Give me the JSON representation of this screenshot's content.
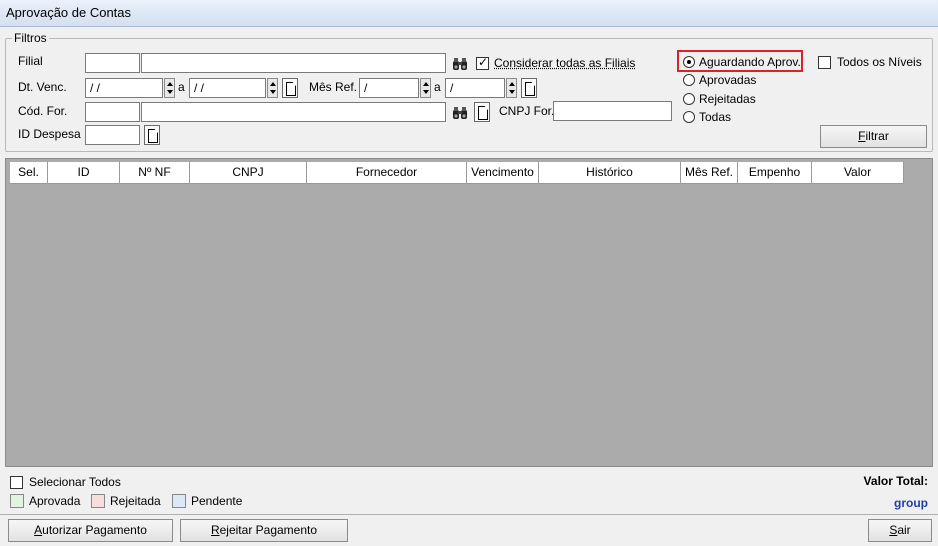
{
  "window": {
    "title": "Aprovação de Contas"
  },
  "filters": {
    "legend": "Filtros",
    "filial": {
      "label": "Filial",
      "code": "",
      "name": ""
    },
    "consider_all": {
      "label": "Considerar todas as Filiais",
      "checked": true
    },
    "dt_venc": {
      "label": "Dt. Venc.",
      "from": " / /",
      "sep": "a",
      "to": " / /"
    },
    "mes_ref": {
      "label": "Mês Ref.",
      "from": " /",
      "sep": "a",
      "to": " /"
    },
    "cod_for": {
      "label": "Cód. For.",
      "code": "",
      "name": ""
    },
    "cnpj_for": {
      "label": "CNPJ For.",
      "value": ""
    },
    "id_despesa": {
      "label": "ID Despesa",
      "value": ""
    },
    "status_options": [
      {
        "label": "Aguardando Aprov.",
        "checked": true
      },
      {
        "label": "Aprovadas",
        "checked": false
      },
      {
        "label": "Rejeitadas",
        "checked": false
      },
      {
        "label": "Todas",
        "checked": false
      }
    ],
    "all_levels": {
      "label": "Todos os Níveis",
      "checked": false
    },
    "filter_button": {
      "label_prefix": "F",
      "label_rest": "iltrar"
    }
  },
  "grid": {
    "columns": [
      "Sel.",
      "ID",
      "Nº NF",
      "CNPJ",
      "Fornecedor",
      "Vencimento",
      "Histórico",
      "Mês Ref.",
      "Empenho",
      "Valor"
    ]
  },
  "footer": {
    "select_all": {
      "label": "Selecionar Todos",
      "checked": false
    },
    "legend": [
      {
        "label": "Aprovada",
        "color": "#dff5df"
      },
      {
        "label": "Rejeitada",
        "color": "#f9dcdc"
      },
      {
        "label": "Pendente",
        "color": "#dce8f9"
      }
    ],
    "total_label": "Valor Total:",
    "total_value": "group",
    "total_value_color": "#1f3fa8"
  },
  "actions": {
    "authorize": {
      "prefix": "A",
      "rest": "utorizar Pagamento"
    },
    "reject": {
      "prefix": "R",
      "rest": "ejeitar Pagamento"
    },
    "exit": {
      "prefix": "S",
      "rest": "air"
    }
  }
}
